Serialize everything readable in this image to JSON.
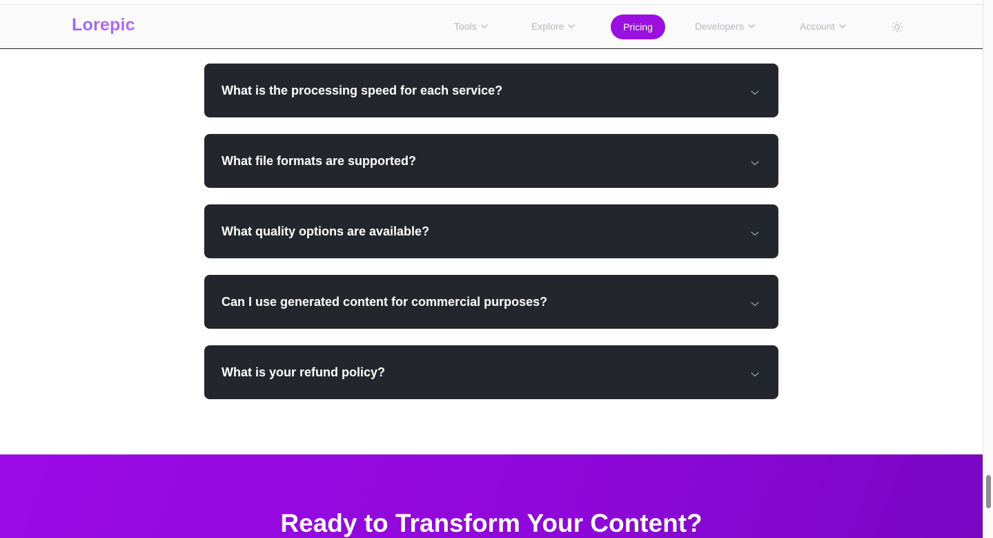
{
  "header": {
    "logo": "Lorepic",
    "nav": {
      "tools": "Tools",
      "explore": "Explore",
      "pricing": "Pricing",
      "developers": "Developers",
      "account": "Account"
    },
    "theme_icon": "sun-icon"
  },
  "faq": {
    "items": [
      {
        "question": "What is the processing speed for each service?"
      },
      {
        "question": "What file formats are supported?"
      },
      {
        "question": "What quality options are available?"
      },
      {
        "question": "Can I use generated content for commercial purposes?"
      },
      {
        "question": "What is your refund policy?"
      }
    ]
  },
  "cta": {
    "title": "Ready to Transform Your Content?"
  },
  "colors": {
    "accent": "#9b10e0",
    "card": "#23262c",
    "logo_gradient": [
      "#9b6cf0",
      "#b968f2"
    ]
  }
}
